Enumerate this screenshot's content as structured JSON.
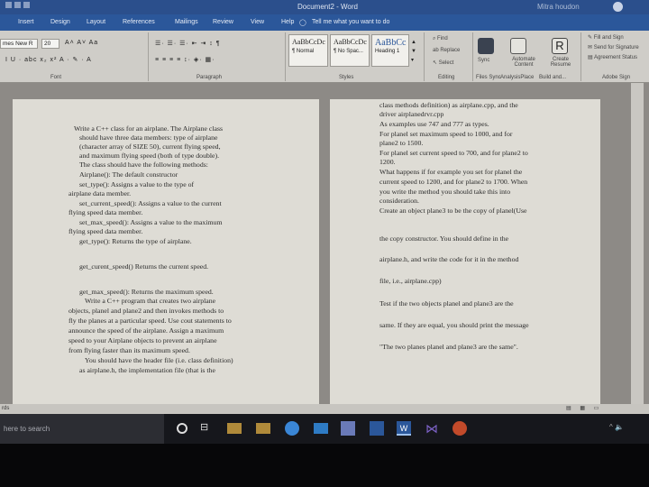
{
  "window": {
    "title": "Document2 - Word",
    "user": "Mitra houdon"
  },
  "ribbon": {
    "tabs": [
      "Insert",
      "Design",
      "Layout",
      "References",
      "Mailings",
      "Review",
      "View",
      "Help"
    ],
    "tell_me": "Tell me what you want to do",
    "font_name": "mes New R",
    "font_size": "20",
    "group_labels": {
      "font": "Font",
      "paragraph": "Paragraph",
      "styles": "Styles",
      "editing": "Editing",
      "adobe": "Adobe Sign"
    },
    "styles": [
      {
        "sample": "AaBbCcDc",
        "name": "¶ Normal"
      },
      {
        "sample": "AaBbCcDc",
        "name": "¶ No Spac..."
      },
      {
        "sample": "AaBbCc",
        "name": "Heading 1"
      }
    ],
    "editing": {
      "find": "Find",
      "replace": "Replace",
      "select": "Select"
    },
    "addins": {
      "sync": "Sync",
      "automate": "Automate Content",
      "create": "Create Resume",
      "sync_bottom": "Files Sync",
      "analysis": "AnalysisPlace",
      "build": "Build and..."
    },
    "adobe": {
      "fill": "Fill and Sign",
      "send": "Send for Signature",
      "status": "Agreement Status"
    }
  },
  "document": {
    "page1": [
      "Write a C++ class for an airplane. The Airplane class",
      "should have three data members: type of airplane",
      "(character array of SIZE 50), current flying speed,",
      "and maximum flying speed (both of type double).",
      "The class should have the following methods:",
      "Airplane():          The default constructor",
      "set_type():          Assigns a value to the type of",
      "airplane data member.",
      "set_current_speed():  Assigns a value to the current",
      "flying speed data member.",
      "set_max_speed(): Assigns a value to the maximum",
      "flying speed data member.",
      "get_type():         Returns the type of airplane.",
      "get_curent_speed()   Returns the current speed.",
      "get_max_speed(): Returns the maximum speed.",
      "Write a C++ program that creates two airplane",
      "objects, planel and plane2 and then invokes methods to",
      "fly the planes at a particular speed. Use cout statements to",
      "announce the speed of the airplane. Assign a maximum",
      "speed to your Airplane objects to prevent an airplane",
      "from flying faster than its maximum speed.",
      "You should have the header file (i.e. class definition)",
      "as airplane.h, the implementation file (that is the"
    ],
    "page2": [
      "class methods definition) as airplane.cpp, and the",
      "driver airplanedrvr.cpp",
      "As examples use 747 and 777 as types.",
      "For planel set maximum speed to 1000, and for",
      "plane2 to 1500.",
      "For planel set current speed to 700, and for plane2 to",
      "1200.",
      "What happens if for example you set for planel the",
      "current speed to 1200, and for plane2 to 1700. When",
      "you write the method you should take this into",
      "consideration.",
      "Create an object plane3 to be the copy of planel(Use",
      "the copy constructor. You should define in the",
      "airplane.h, and write the code for it in the method",
      "file, i.e., airplane.cpp)",
      "Test if the two objects planel and plane3 are the",
      "same. If they are equal, you should print the message",
      "\"The two planes planel and plane3 are the same\"."
    ]
  },
  "statusbar": {
    "words": "rds"
  },
  "taskbar": {
    "search_placeholder": "here to search"
  },
  "colors": {
    "title_bar": "#2b4f8c",
    "ribbon": "#cfcdc8",
    "page": "#dedcd5",
    "taskbar": "#16171c"
  }
}
